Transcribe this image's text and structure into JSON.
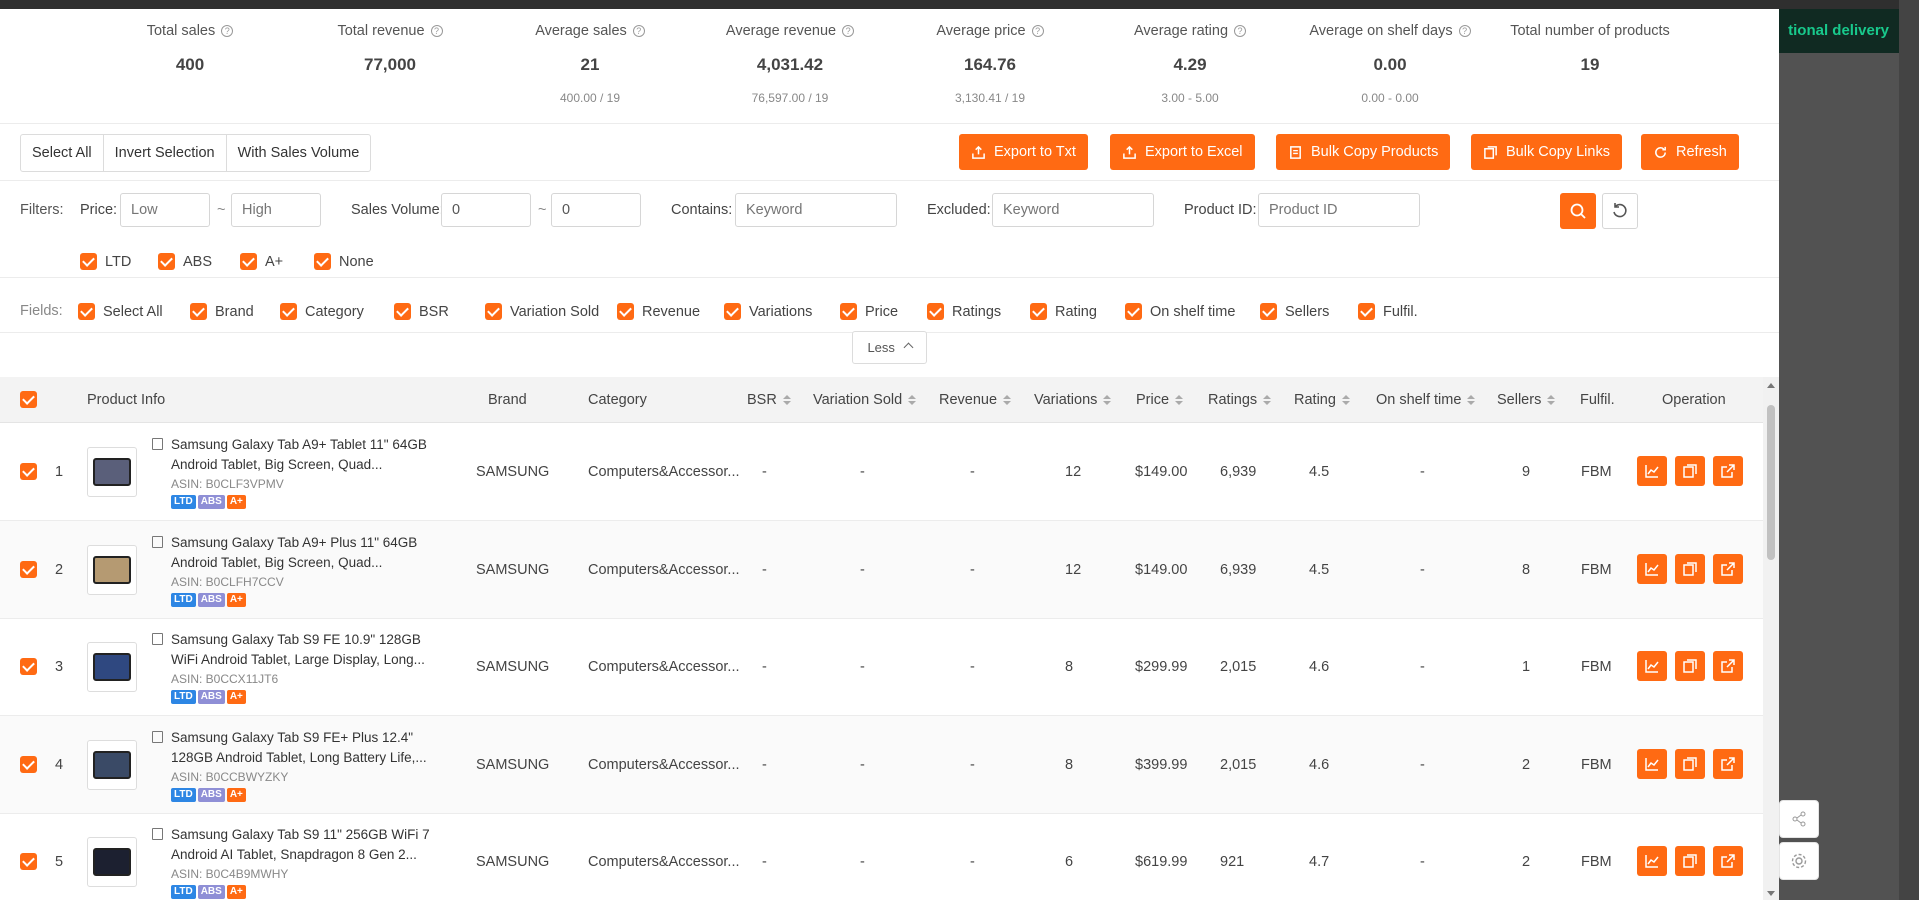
{
  "right_banner": "tional delivery",
  "stats": [
    {
      "label": "Total sales",
      "value": "400",
      "sub": ""
    },
    {
      "label": "Total revenue",
      "value": "77,000",
      "sub": ""
    },
    {
      "label": "Average sales",
      "value": "21",
      "sub": "400.00 / 19"
    },
    {
      "label": "Average revenue",
      "value": "4,031.42",
      "sub": "76,597.00 / 19"
    },
    {
      "label": "Average price",
      "value": "164.76",
      "sub": "3,130.41 / 19"
    },
    {
      "label": "Average rating",
      "value": "4.29",
      "sub": "3.00 - 5.00"
    },
    {
      "label": "Average on shelf days",
      "value": "0.00",
      "sub": "0.00 - 0.00"
    },
    {
      "label": "Total number of products",
      "value": "19",
      "sub": ""
    }
  ],
  "toolbar": {
    "select_all": "Select All",
    "invert_selection": "Invert Selection",
    "with_sales_volume": "With Sales Volume",
    "export_txt": "Export to Txt",
    "export_excel": "Export to Excel",
    "bulk_copy_products": "Bulk Copy Products",
    "bulk_copy_links": "Bulk Copy Links",
    "refresh": "Refresh"
  },
  "filters": {
    "label": "Filters:",
    "price_label": "Price:",
    "price_low_placeholder": "Low",
    "price_high_placeholder": "High",
    "sales_volume_label": "Sales Volume:",
    "sales_min": "0",
    "sales_max": "0",
    "contains_label": "Contains:",
    "contains_placeholder": "Keyword",
    "excluded_label": "Excluded:",
    "excluded_placeholder": "Keyword",
    "product_id_label": "Product ID:",
    "product_id_placeholder": "Product ID",
    "tilde": "~",
    "badges": [
      "LTD",
      "ABS",
      "A+",
      "None"
    ]
  },
  "fields": {
    "label": "Fields:",
    "items": [
      "Select All",
      "Brand",
      "Category",
      "BSR",
      "Variation Sold",
      "Revenue",
      "Variations",
      "Price",
      "Ratings",
      "Rating",
      "On shelf time",
      "Sellers",
      "Fulfil."
    ]
  },
  "less_label": "Less",
  "table": {
    "headers": {
      "product_info": "Product Info",
      "brand": "Brand",
      "category": "Category",
      "bsr": "BSR",
      "variation_sold": "Variation Sold",
      "revenue": "Revenue",
      "variations": "Variations",
      "price": "Price",
      "ratings": "Ratings",
      "rating": "Rating",
      "on_shelf_time": "On shelf time",
      "sellers": "Sellers",
      "fulfil": "Fulfil.",
      "operation": "Operation"
    },
    "rows": [
      {
        "idx": "1",
        "title": "Samsung Galaxy Tab A9+ Tablet 11\" 64GB Android Tablet, Big Screen, Quad...",
        "asin": "ASIN: B0CLF3VPMV",
        "brand": "SAMSUNG",
        "category": "Computers&Accessor...",
        "bsr": "-",
        "variation_sold": "-",
        "revenue": "-",
        "variations": "12",
        "price": "$149.00",
        "ratings": "6,939",
        "rating": "4.5",
        "on_shelf": "-",
        "sellers": "9",
        "fulfil": "FBM",
        "img_color": "#5a5f7a"
      },
      {
        "idx": "2",
        "title": "Samsung Galaxy Tab A9+ Plus 11\" 64GB Android Tablet, Big Screen, Quad...",
        "asin": "ASIN: B0CLFH7CCV",
        "brand": "SAMSUNG",
        "category": "Computers&Accessor...",
        "bsr": "-",
        "variation_sold": "-",
        "revenue": "-",
        "variations": "12",
        "price": "$149.00",
        "ratings": "6,939",
        "rating": "4.5",
        "on_shelf": "-",
        "sellers": "8",
        "fulfil": "FBM",
        "img_color": "#b59a72"
      },
      {
        "idx": "3",
        "title": "Samsung Galaxy Tab S9 FE 10.9\" 128GB WiFi Android Tablet, Large Display, Long...",
        "asin": "ASIN: B0CCX11JT6",
        "brand": "SAMSUNG",
        "category": "Computers&Accessor...",
        "bsr": "-",
        "variation_sold": "-",
        "revenue": "-",
        "variations": "8",
        "price": "$299.99",
        "ratings": "2,015",
        "rating": "4.6",
        "on_shelf": "-",
        "sellers": "1",
        "fulfil": "FBM",
        "img_color": "#2f4880"
      },
      {
        "idx": "4",
        "title": "Samsung Galaxy Tab S9 FE+ Plus 12.4\" 128GB Android Tablet, Long Battery Life,...",
        "asin": "ASIN: B0CCBWYZKY",
        "brand": "SAMSUNG",
        "category": "Computers&Accessor...",
        "bsr": "-",
        "variation_sold": "-",
        "revenue": "-",
        "variations": "8",
        "price": "$399.99",
        "ratings": "2,015",
        "rating": "4.6",
        "on_shelf": "-",
        "sellers": "2",
        "fulfil": "FBM",
        "img_color": "#3a4a66"
      },
      {
        "idx": "5",
        "title": "Samsung Galaxy Tab S9 11\" 256GB WiFi 7 Android AI Tablet, Snapdragon 8 Gen 2...",
        "asin": "ASIN: B0C4B9MWHY",
        "brand": "SAMSUNG",
        "category": "Computers&Accessor...",
        "bsr": "-",
        "variation_sold": "-",
        "revenue": "-",
        "variations": "6",
        "price": "$619.99",
        "ratings": "921",
        "rating": "4.7",
        "on_shelf": "-",
        "sellers": "2",
        "fulfil": "FBM",
        "img_color": "#1c2030"
      }
    ]
  },
  "colors": {
    "accent": "#ff6a13",
    "ltd": "#2d86e4",
    "abs": "#8f8fd6",
    "banner_text": "#18c98c"
  }
}
